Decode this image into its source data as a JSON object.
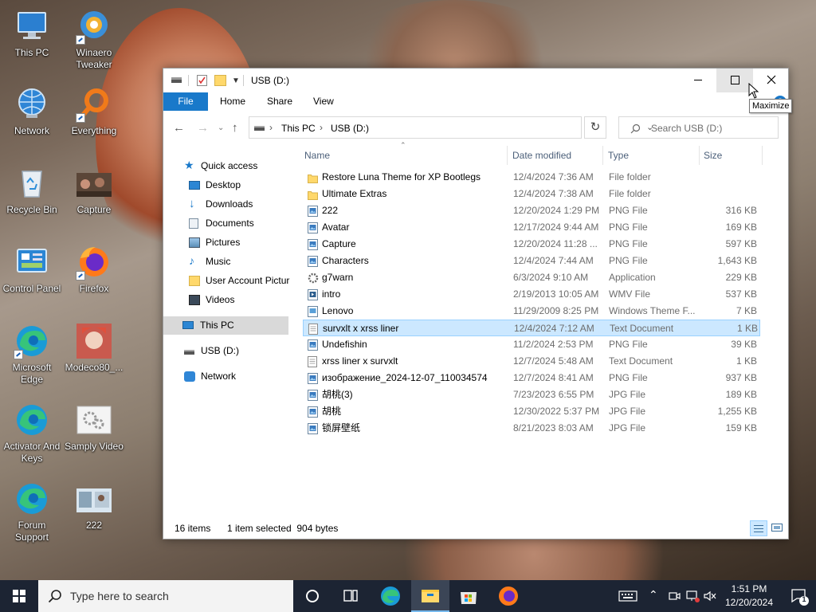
{
  "desktop": {
    "icons": [
      {
        "label": "This PC"
      },
      {
        "label": "Winaero Tweaker"
      },
      {
        "label": "Network"
      },
      {
        "label": "Everything"
      },
      {
        "label": "Recycle Bin"
      },
      {
        "label": "Capture"
      },
      {
        "label": "Control Panel"
      },
      {
        "label": "Firefox"
      },
      {
        "label": "Microsoft Edge"
      },
      {
        "label": "Modeco80_..."
      },
      {
        "label": "Activator And Keys"
      },
      {
        "label": "Samply Video"
      },
      {
        "label": "Forum Support"
      },
      {
        "label": "222"
      }
    ]
  },
  "explorer": {
    "title": "USB (D:)",
    "ribbon_tabs": [
      "File",
      "Home",
      "Share",
      "View"
    ],
    "address": {
      "segments": [
        "This PC",
        "USB (D:)"
      ],
      "separator": "›"
    },
    "search_placeholder": "Search USB (D:)",
    "tooltip": "Maximize",
    "nav": {
      "quick_access": "Quick access",
      "quick_items": [
        {
          "label": "Desktop",
          "icon": "desktop-icon",
          "pinned": true
        },
        {
          "label": "Downloads",
          "icon": "downloads-icon",
          "pinned": true
        },
        {
          "label": "Documents",
          "icon": "documents-icon",
          "pinned": true
        },
        {
          "label": "Pictures",
          "icon": "pictures-icon",
          "pinned": true
        },
        {
          "label": "Music",
          "icon": "music-icon",
          "pinned": false
        },
        {
          "label": "User Account Pictur",
          "icon": "folder-icon",
          "pinned": false
        },
        {
          "label": "Videos",
          "icon": "videos-icon",
          "pinned": false
        }
      ],
      "this_pc": "This PC",
      "usb": "USB (D:)",
      "network": "Network"
    },
    "columns": {
      "name": "Name",
      "date": "Date modified",
      "type": "Type",
      "size": "Size"
    },
    "files": [
      {
        "name": "Restore Luna Theme for XP Bootlegs",
        "date": "12/4/2024 7:36 AM",
        "type": "File folder",
        "size": "",
        "icon": "folder"
      },
      {
        "name": "Ultimate Extras",
        "date": "12/4/2024 7:38 AM",
        "type": "File folder",
        "size": "",
        "icon": "folder"
      },
      {
        "name": "222",
        "date": "12/20/2024 1:29 PM",
        "type": "PNG File",
        "size": "316 KB",
        "icon": "image"
      },
      {
        "name": "Avatar",
        "date": "12/17/2024 9:44 AM",
        "type": "PNG File",
        "size": "169 KB",
        "icon": "image"
      },
      {
        "name": "Capture",
        "date": "12/20/2024 11:28 ...",
        "type": "PNG File",
        "size": "597 KB",
        "icon": "image"
      },
      {
        "name": "Characters",
        "date": "12/4/2024 7:44 AM",
        "type": "PNG File",
        "size": "1,643 KB",
        "icon": "image"
      },
      {
        "name": "g7warn",
        "date": "6/3/2024 9:10 AM",
        "type": "Application",
        "size": "229 KB",
        "icon": "app"
      },
      {
        "name": "intro",
        "date": "2/19/2013 10:05 AM",
        "type": "WMV File",
        "size": "537 KB",
        "icon": "video"
      },
      {
        "name": "Lenovo",
        "date": "11/29/2009 8:25 PM",
        "type": "Windows Theme F...",
        "size": "7 KB",
        "icon": "theme"
      },
      {
        "name": "survxlt x xrss liner",
        "date": "12/4/2024 7:12 AM",
        "type": "Text Document",
        "size": "1 KB",
        "icon": "text",
        "selected": true
      },
      {
        "name": "Undefishin",
        "date": "11/2/2024 2:53 PM",
        "type": "PNG File",
        "size": "39 KB",
        "icon": "image"
      },
      {
        "name": "xrss liner x survxlt",
        "date": "12/7/2024 5:48 AM",
        "type": "Text Document",
        "size": "1 KB",
        "icon": "text"
      },
      {
        "name": "изображение_2024-12-07_110034574",
        "date": "12/7/2024 8:41 AM",
        "type": "PNG File",
        "size": "937 KB",
        "icon": "image"
      },
      {
        "name": "胡桃(3)",
        "date": "7/23/2023 6:55 PM",
        "type": "JPG File",
        "size": "189 KB",
        "icon": "image"
      },
      {
        "name": "胡桃",
        "date": "12/30/2022 5:37 PM",
        "type": "JPG File",
        "size": "1,255 KB",
        "icon": "image"
      },
      {
        "name": "锁屏壁纸",
        "date": "8/21/2023 8:03 AM",
        "type": "JPG File",
        "size": "159 KB",
        "icon": "image"
      }
    ],
    "status": {
      "count": "16 items",
      "selection": "1 item selected  904 bytes"
    }
  },
  "taskbar": {
    "search_placeholder": "Type here to search",
    "time": "1:51 PM",
    "date": "12/20/2024",
    "notification_count": "1"
  },
  "colors": {
    "accent": "#1979ca",
    "selection": "#cce8ff",
    "taskbar": "#1c2433",
    "folder": "#ffd86b"
  }
}
